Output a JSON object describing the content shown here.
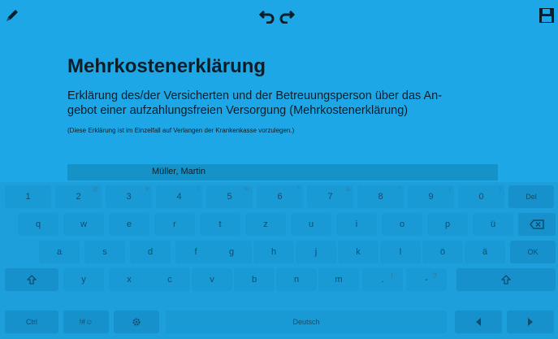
{
  "toolbar": {
    "icons": [
      "pencil-icon",
      "undo-icon",
      "redo-icon",
      "save-icon"
    ]
  },
  "document": {
    "title": "Mehrkostenerklärung",
    "line1": "Erklärung des/der Versicherten und der Betreuungsperson über das An-",
    "line2": "gebot einer aufzahlungsfreien Versorgung (Mehrkostenerklärung)",
    "note": "(Diese Erklärung ist im Einzelfall auf Verlangen der Krankenkasse vorzulegen.)",
    "name": "Müller, Martin"
  },
  "keyboard": {
    "row1": [
      {
        "label": "1",
        "sub": "`"
      },
      {
        "label": "2",
        "sub": "@"
      },
      {
        "label": "3",
        "sub": "#"
      },
      {
        "label": "4",
        "sub": "/"
      },
      {
        "label": "5",
        "sub": "%"
      },
      {
        "label": "6",
        "sub": "^"
      },
      {
        "label": "7",
        "sub": "&"
      },
      {
        "label": "8",
        "sub": "*"
      },
      {
        "label": "9",
        "sub": "("
      },
      {
        "label": "0",
        "sub": ")"
      },
      {
        "label": "Del",
        "sub": ""
      }
    ],
    "row2": [
      "q",
      "w",
      "e",
      "r",
      "t",
      "z",
      "u",
      "i",
      "o",
      "p",
      "ü"
    ],
    "row3": [
      "a",
      "s",
      "d",
      "f",
      "g",
      "h",
      "j",
      "k",
      "l",
      "ö",
      "ä",
      "OK"
    ],
    "row4": [
      "y",
      "x",
      "c",
      "v",
      "b",
      "n",
      "m"
    ],
    "row4_punct1": {
      "label": ".",
      "sub": "!"
    },
    "row4_punct2": {
      "label": "-",
      "sub": "?"
    },
    "row5": {
      "ctrl": "Ctrl",
      "sym": "!#☺",
      "space": "Deutsch"
    },
    "icons": [
      "backspace-icon",
      "shift-icon",
      "gear-icon",
      "arrow-left-icon",
      "arrow-right-icon"
    ]
  },
  "colors": {
    "background": "#1EA7E6",
    "key": "#1A9AD5",
    "text": "#0A1E2A"
  }
}
